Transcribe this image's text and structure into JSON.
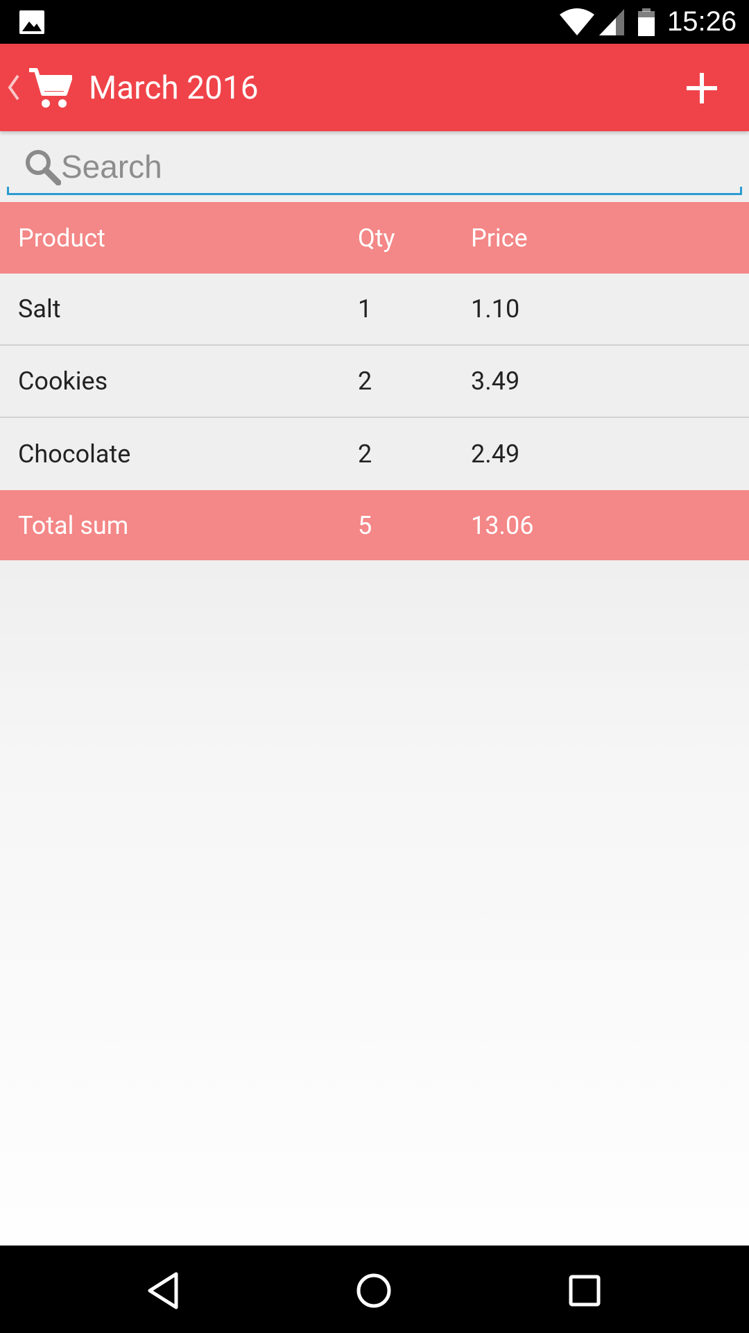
{
  "status_bar": {
    "time": "15:26",
    "icons": [
      "image-notification-icon",
      "wifi-icon",
      "signal-icon",
      "battery-icon"
    ]
  },
  "action_bar": {
    "title": "March 2016",
    "icons": [
      "back-chevron-icon",
      "shopping-cart-icon",
      "plus-icon"
    ],
    "color": "#ef4349"
  },
  "search": {
    "placeholder": "Search",
    "value": ""
  },
  "table": {
    "headers": {
      "product": "Product",
      "qty": "Qty",
      "price": "Price"
    },
    "rows": [
      {
        "product": "Salt",
        "qty": "1",
        "price": "1.10"
      },
      {
        "product": "Cookies",
        "qty": "2",
        "price": "3.49"
      },
      {
        "product": "Chocolate",
        "qty": "2",
        "price": "2.49"
      }
    ],
    "total": {
      "label": "Total sum",
      "qty": "5",
      "price": "13.06"
    },
    "accent_color": "#f48787"
  },
  "nav_bar": {
    "icons": [
      "back-triangle-icon",
      "home-circle-icon",
      "recents-square-icon"
    ]
  }
}
